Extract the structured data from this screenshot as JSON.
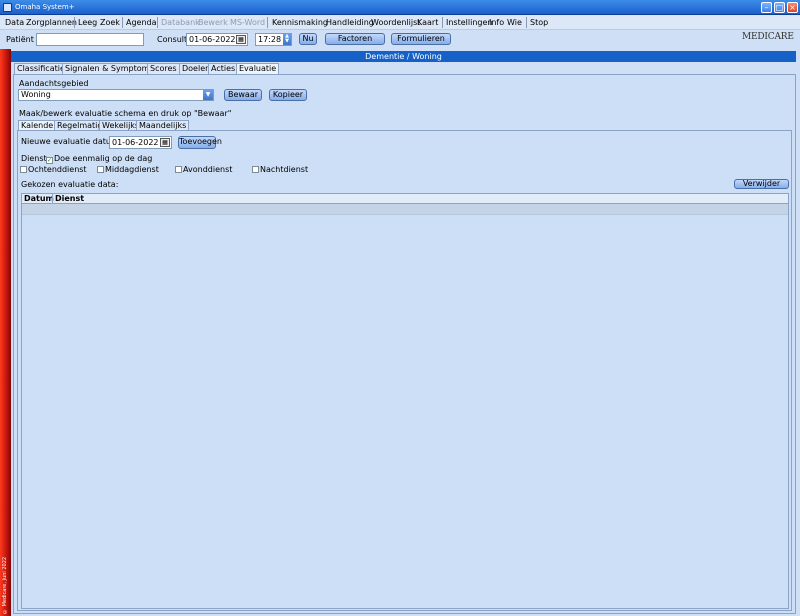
{
  "window": {
    "title": "Omaha System+"
  },
  "menu": {
    "items": [
      {
        "label": "Data",
        "disabled": false
      },
      {
        "label": "Zorgplannen",
        "disabled": false
      },
      {
        "label": "Leeg",
        "disabled": false
      },
      {
        "label": "Zoek",
        "disabled": false
      },
      {
        "label": "Agenda",
        "disabled": false
      },
      {
        "label": "Databank",
        "disabled": true
      },
      {
        "label": "Bewerk",
        "disabled": true
      },
      {
        "label": "MS-Word",
        "disabled": true
      },
      {
        "label": "Kennismaking",
        "disabled": false
      },
      {
        "label": "Handleiding",
        "disabled": false
      },
      {
        "label": "Woordenlijst",
        "disabled": false
      },
      {
        "label": "Kaart",
        "disabled": false
      },
      {
        "label": "Instellingen",
        "disabled": false
      },
      {
        "label": "Info",
        "disabled": false
      },
      {
        "label": "Wie",
        "disabled": false
      },
      {
        "label": "Stop",
        "disabled": false
      }
    ]
  },
  "toolbar": {
    "patient_label": "Patiënt",
    "patient_value": "",
    "consult_label": "Consult",
    "consult_date": "01-06-2022",
    "consult_time": "17:28",
    "now_label": "Nu",
    "factors_label": "Factoren",
    "forms_label": "Formulieren"
  },
  "logo": {
    "text": "MEDICARE"
  },
  "sidebar": {
    "copyright": "© Medicare, Juni 2022"
  },
  "section": {
    "title": "Dementie / Woning"
  },
  "main_tabs": [
    {
      "label": "Classificatie",
      "active": false
    },
    {
      "label": "Signalen & Symptomen",
      "active": false
    },
    {
      "label": "Scores",
      "active": false
    },
    {
      "label": "Doelen",
      "active": false
    },
    {
      "label": "Acties",
      "active": false
    },
    {
      "label": "Evaluatie",
      "active": true
    }
  ],
  "evaluation": {
    "focus_label": "Aandachtsgebied",
    "focus_value": "Woning",
    "save_label": "Bewaar",
    "copy_label": "Kopieer",
    "instruction": "Maak/bewerk evaluatie schema en druk op \"Bewaar\"",
    "schedule_tabs": [
      {
        "label": "Kalender",
        "active": true
      },
      {
        "label": "Regelmatig",
        "active": false
      },
      {
        "label": "Wekelijks",
        "active": false
      },
      {
        "label": "Maandelijks",
        "active": false
      }
    ],
    "new_date_label": "Nieuwe evaluatie datum:",
    "new_date_value": "01-06-2022",
    "add_label": "Toevoegen",
    "service_label": "Dienst:",
    "once_label": "Doe eenmalig op de dag",
    "once_checked": true,
    "shifts": [
      {
        "label": "Ochtenddienst",
        "checked": false
      },
      {
        "label": "Middagdienst",
        "checked": false
      },
      {
        "label": "Avonddienst",
        "checked": false
      },
      {
        "label": "Nachtdienst",
        "checked": false
      }
    ],
    "selected_label": "Gekozen evaluatie data:",
    "remove_label": "Verwijder",
    "columns": [
      "Datum",
      "Dienst"
    ]
  }
}
